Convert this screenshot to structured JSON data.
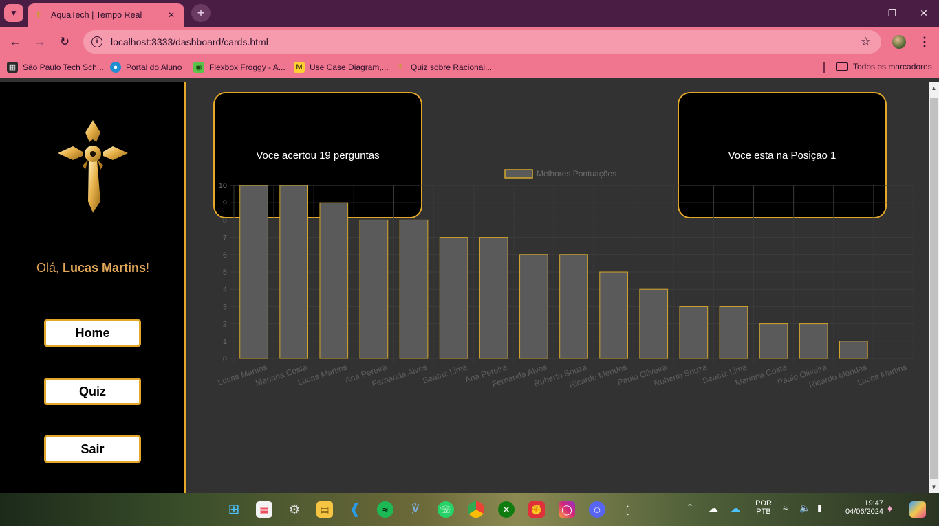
{
  "browser": {
    "tab_title": "AquaTech | Tempo Real",
    "url": "localhost:3333/dashboard/cards.html",
    "bookmarks": [
      {
        "label": "São Paulo Tech Sch...",
        "icon": "sptech-icon"
      },
      {
        "label": "Portal do Aluno",
        "icon": "portal-icon"
      },
      {
        "label": "Flexbox Froggy - A...",
        "icon": "frog-icon"
      },
      {
        "label": "Use Case Diagram,...",
        "icon": "miro-icon"
      },
      {
        "label": "Quiz sobre Racionai...",
        "icon": "cross-icon"
      }
    ],
    "all_bookmarks_label": "Todos os marcadores"
  },
  "sidebar": {
    "greeting_prefix": "Olá, ",
    "user_name": "Lucas Martins",
    "greeting_suffix": "!",
    "nav": {
      "home": "Home",
      "quiz": "Quiz",
      "logout": "Sair"
    }
  },
  "cards": {
    "correct_answers": "Voce acertou 19 perguntas",
    "position": "Voce esta na Posiçao 1"
  },
  "colors": {
    "accent": "#e3a82a",
    "page_bg": "#323232",
    "bar_fill": "#5a5a5a",
    "bar_border": "#d4a72c"
  },
  "chart_data": {
    "type": "bar",
    "legend": "Melhores Pontuações",
    "categories": [
      "Lucas Martins",
      "Mariana Costa",
      "Lucas Martins",
      "Ana Pereira",
      "Fernanda Alves",
      "Beatriz Lima",
      "Ana Pereira",
      "Fernanda Alves",
      "Roberto Souza",
      "Ricardo Mendes",
      "Paulo Oliveira",
      "Roberto Souza",
      "Beatriz Lima",
      "Mariana Costa",
      "Paulo Oliveira",
      "Ricardo Mendes",
      "Lucas Martins"
    ],
    "values": [
      10,
      10,
      9,
      8,
      8,
      7,
      7,
      6,
      6,
      5,
      4,
      3,
      3,
      2,
      2,
      1,
      0
    ],
    "ylim": [
      0,
      10
    ],
    "yticks": [
      "0",
      "1",
      "2",
      "3",
      "4",
      "5",
      "6",
      "7",
      "8",
      "9",
      "10"
    ],
    "grid": true
  },
  "taskbar": {
    "language_line1": "POR",
    "language_line2": "PTB",
    "time": "19:47",
    "date": "04/06/2024"
  }
}
